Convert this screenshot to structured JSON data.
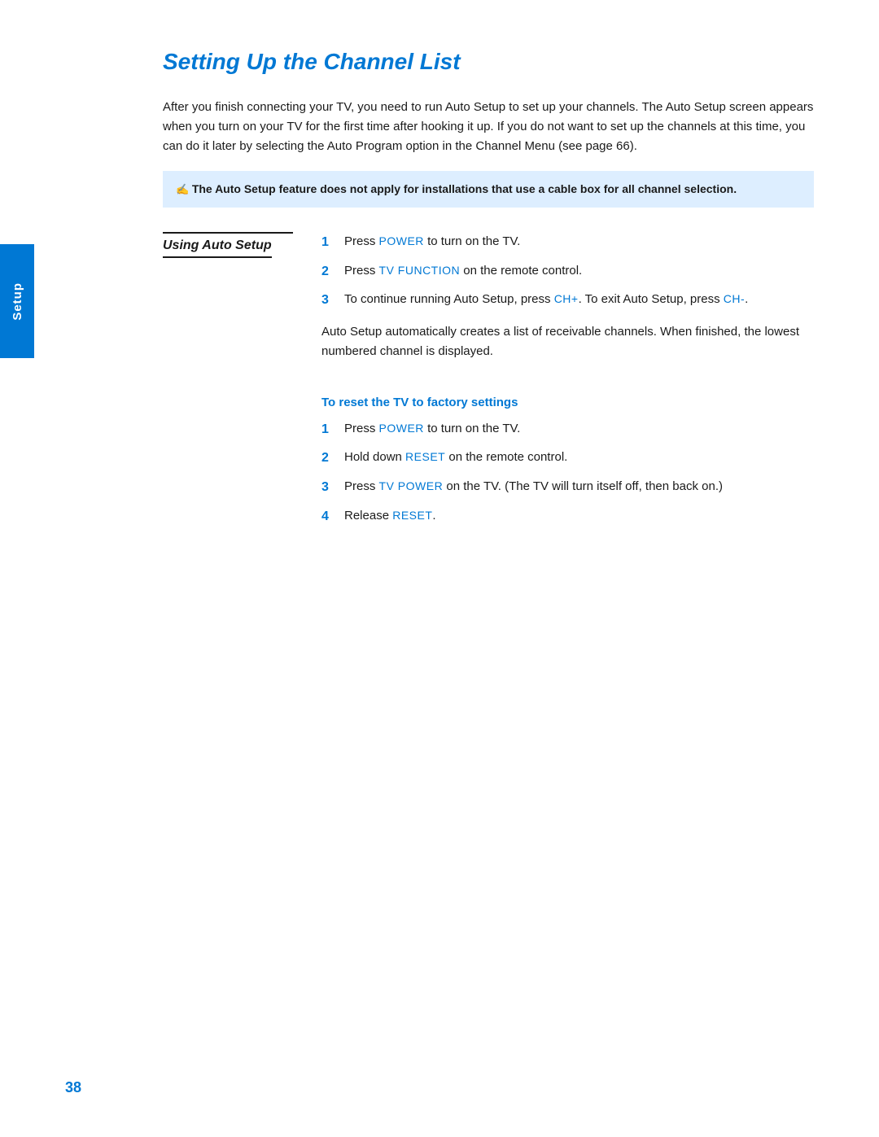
{
  "page": {
    "title": "Setting Up the Channel List",
    "page_number": "38",
    "sidebar_label": "Setup"
  },
  "intro": {
    "text": "After you finish connecting your TV, you need to run Auto Setup to set up your channels. The Auto Setup screen appears when you turn on your TV for the first time after hooking it up. If you do not want to set up the channels at this time, you can do it later by selecting the Auto Program option in the Channel Menu (see page 66)."
  },
  "note": {
    "icon": "✍",
    "text": "The Auto Setup feature does not apply for installations that use a cable box for all channel selection."
  },
  "using_auto_setup": {
    "label": "Using Auto Setup",
    "steps": [
      {
        "number": "1",
        "text_parts": [
          {
            "text": "Press ",
            "type": "normal"
          },
          {
            "text": "POWER",
            "type": "blue"
          },
          {
            "text": " to turn on the TV.",
            "type": "normal"
          }
        ],
        "full_text": "Press POWER to turn on the TV."
      },
      {
        "number": "2",
        "text_parts": [
          {
            "text": "Press ",
            "type": "normal"
          },
          {
            "text": "TV FUNCTION",
            "type": "blue"
          },
          {
            "text": " on the remote control.",
            "type": "normal"
          }
        ],
        "full_text": "Press TV FUNCTION on the remote control."
      },
      {
        "number": "3",
        "text_parts": [
          {
            "text": "To continue running Auto Setup, press ",
            "type": "normal"
          },
          {
            "text": "CH+",
            "type": "blue"
          },
          {
            "text": ". To exit Auto Setup, press ",
            "type": "normal"
          },
          {
            "text": "CH-",
            "type": "blue"
          },
          {
            "text": ".",
            "type": "normal"
          }
        ],
        "full_text": "To continue running Auto Setup, press CH+. To exit Auto Setup, press CH-."
      }
    ],
    "auto_description": "Auto Setup automatically creates a list of receivable channels. When finished, the lowest numbered channel is displayed."
  },
  "factory_reset": {
    "heading": "To reset the TV to factory settings",
    "steps": [
      {
        "number": "1",
        "text_parts": [
          {
            "text": "Press ",
            "type": "normal"
          },
          {
            "text": "POWER",
            "type": "blue"
          },
          {
            "text": " to turn on the TV.",
            "type": "normal"
          }
        ],
        "full_text": "Press POWER to turn on the TV."
      },
      {
        "number": "2",
        "text_parts": [
          {
            "text": "Hold down ",
            "type": "normal"
          },
          {
            "text": "RESET",
            "type": "blue"
          },
          {
            "text": " on the remote control.",
            "type": "normal"
          }
        ],
        "full_text": "Hold down RESET on the remote control."
      },
      {
        "number": "3",
        "text_parts": [
          {
            "text": "Press ",
            "type": "normal"
          },
          {
            "text": "TV POWER",
            "type": "blue"
          },
          {
            "text": " on the TV. (The TV will turn itself off, then back on.)",
            "type": "normal"
          }
        ],
        "full_text": "Press TV POWER on the TV. (The TV will turn itself off, then back on.)"
      },
      {
        "number": "4",
        "text_parts": [
          {
            "text": "Release ",
            "type": "normal"
          },
          {
            "text": "RESET",
            "type": "blue"
          },
          {
            "text": ".",
            "type": "normal"
          }
        ],
        "full_text": "Release RESET."
      }
    ]
  },
  "colors": {
    "blue": "#0078d4",
    "sidebar_bg": "#0078d4",
    "note_bg": "#ddeeff",
    "text": "#1a1a1a",
    "white": "#ffffff"
  }
}
